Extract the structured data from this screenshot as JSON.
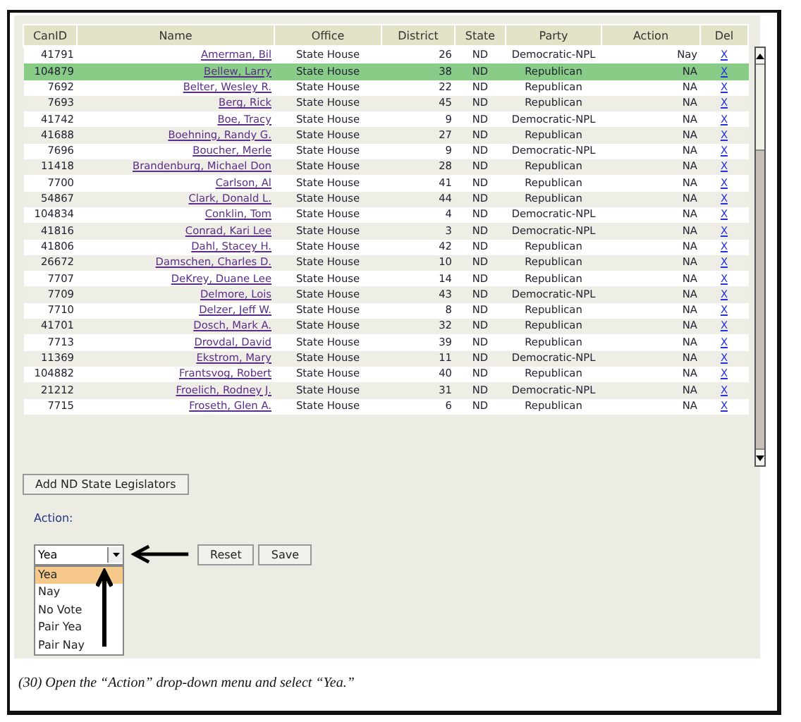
{
  "table": {
    "columns": [
      "CanID",
      "Name",
      "Office",
      "District",
      "State",
      "Party",
      "Action",
      "Del"
    ],
    "rows": [
      {
        "canid": "41791",
        "name": "Amerman, Bil",
        "office": "State House",
        "district": "26",
        "state": "ND",
        "party": "Democratic-NPL",
        "action": "Nay",
        "del": "X",
        "selected": false
      },
      {
        "canid": "104879",
        "name": "Bellew, Larry",
        "office": "State House",
        "district": "38",
        "state": "ND",
        "party": "Republican",
        "action": "NA",
        "del": "X",
        "selected": true
      },
      {
        "canid": "7692",
        "name": "Belter, Wesley R.",
        "office": "State House",
        "district": "22",
        "state": "ND",
        "party": "Republican",
        "action": "NA",
        "del": "X",
        "selected": false
      },
      {
        "canid": "7693",
        "name": "Berg, Rick",
        "office": "State House",
        "district": "45",
        "state": "ND",
        "party": "Republican",
        "action": "NA",
        "del": "X",
        "selected": false
      },
      {
        "canid": "41742",
        "name": "Boe, Tracy",
        "office": "State House",
        "district": "9",
        "state": "ND",
        "party": "Democratic-NPL",
        "action": "NA",
        "del": "X",
        "selected": false
      },
      {
        "canid": "41688",
        "name": "Boehning, Randy G.",
        "office": "State House",
        "district": "27",
        "state": "ND",
        "party": "Republican",
        "action": "NA",
        "del": "X",
        "selected": false
      },
      {
        "canid": "7696",
        "name": "Boucher, Merle",
        "office": "State House",
        "district": "9",
        "state": "ND",
        "party": "Democratic-NPL",
        "action": "NA",
        "del": "X",
        "selected": false
      },
      {
        "canid": "11418",
        "name": "Brandenburg, Michael Don",
        "office": "State House",
        "district": "28",
        "state": "ND",
        "party": "Republican",
        "action": "NA",
        "del": "X",
        "selected": false
      },
      {
        "canid": "7700",
        "name": "Carlson, Al",
        "office": "State House",
        "district": "41",
        "state": "ND",
        "party": "Republican",
        "action": "NA",
        "del": "X",
        "selected": false
      },
      {
        "canid": "54867",
        "name": "Clark, Donald L.",
        "office": "State House",
        "district": "44",
        "state": "ND",
        "party": "Republican",
        "action": "NA",
        "del": "X",
        "selected": false
      },
      {
        "canid": "104834",
        "name": "Conklin, Tom",
        "office": "State House",
        "district": "4",
        "state": "ND",
        "party": "Democratic-NPL",
        "action": "NA",
        "del": "X",
        "selected": false
      },
      {
        "canid": "41816",
        "name": "Conrad, Kari Lee",
        "office": "State House",
        "district": "3",
        "state": "ND",
        "party": "Democratic-NPL",
        "action": "NA",
        "del": "X",
        "selected": false
      },
      {
        "canid": "41806",
        "name": "Dahl, Stacey H.",
        "office": "State House",
        "district": "42",
        "state": "ND",
        "party": "Republican",
        "action": "NA",
        "del": "X",
        "selected": false
      },
      {
        "canid": "26672",
        "name": "Damschen, Charles D.",
        "office": "State House",
        "district": "10",
        "state": "ND",
        "party": "Republican",
        "action": "NA",
        "del": "X",
        "selected": false
      },
      {
        "canid": "7707",
        "name": "DeKrey, Duane Lee",
        "office": "State House",
        "district": "14",
        "state": "ND",
        "party": "Republican",
        "action": "NA",
        "del": "X",
        "selected": false
      },
      {
        "canid": "7709",
        "name": "Delmore, Lois",
        "office": "State House",
        "district": "43",
        "state": "ND",
        "party": "Democratic-NPL",
        "action": "NA",
        "del": "X",
        "selected": false
      },
      {
        "canid": "7710",
        "name": "Delzer, Jeff W.",
        "office": "State House",
        "district": "8",
        "state": "ND",
        "party": "Republican",
        "action": "NA",
        "del": "X",
        "selected": false
      },
      {
        "canid": "41701",
        "name": "Dosch, Mark A.",
        "office": "State House",
        "district": "32",
        "state": "ND",
        "party": "Republican",
        "action": "NA",
        "del": "X",
        "selected": false
      },
      {
        "canid": "7713",
        "name": "Drovdal, David",
        "office": "State House",
        "district": "39",
        "state": "ND",
        "party": "Republican",
        "action": "NA",
        "del": "X",
        "selected": false
      },
      {
        "canid": "11369",
        "name": "Ekstrom, Mary",
        "office": "State House",
        "district": "11",
        "state": "ND",
        "party": "Democratic-NPL",
        "action": "NA",
        "del": "X",
        "selected": false
      },
      {
        "canid": "104882",
        "name": "Frantsvog, Robert",
        "office": "State House",
        "district": "40",
        "state": "ND",
        "party": "Republican",
        "action": "NA",
        "del": "X",
        "selected": false
      },
      {
        "canid": "21212",
        "name": "Froelich, Rodney J.",
        "office": "State House",
        "district": "31",
        "state": "ND",
        "party": "Democratic-NPL",
        "action": "NA",
        "del": "X",
        "selected": false
      },
      {
        "canid": "7715",
        "name": "Froseth, Glen A.",
        "office": "State House",
        "district": "6",
        "state": "ND",
        "party": "Republican",
        "action": "NA",
        "del": "X",
        "selected": false
      }
    ]
  },
  "add_button": "Add ND State Legislators",
  "action_label": "Action:",
  "action_select": {
    "value": "Yea",
    "options": [
      {
        "label": "Yea",
        "selected": true
      },
      {
        "label": "Nay",
        "selected": false
      },
      {
        "label": "No Vote",
        "selected": false
      },
      {
        "label": "Pair Yea",
        "selected": false
      },
      {
        "label": "Pair Nay",
        "selected": false
      }
    ]
  },
  "buttons": [
    "Reset",
    "Save"
  ],
  "caption": "(30) Open the “Action” drop-down menu and select “Yea.”"
}
